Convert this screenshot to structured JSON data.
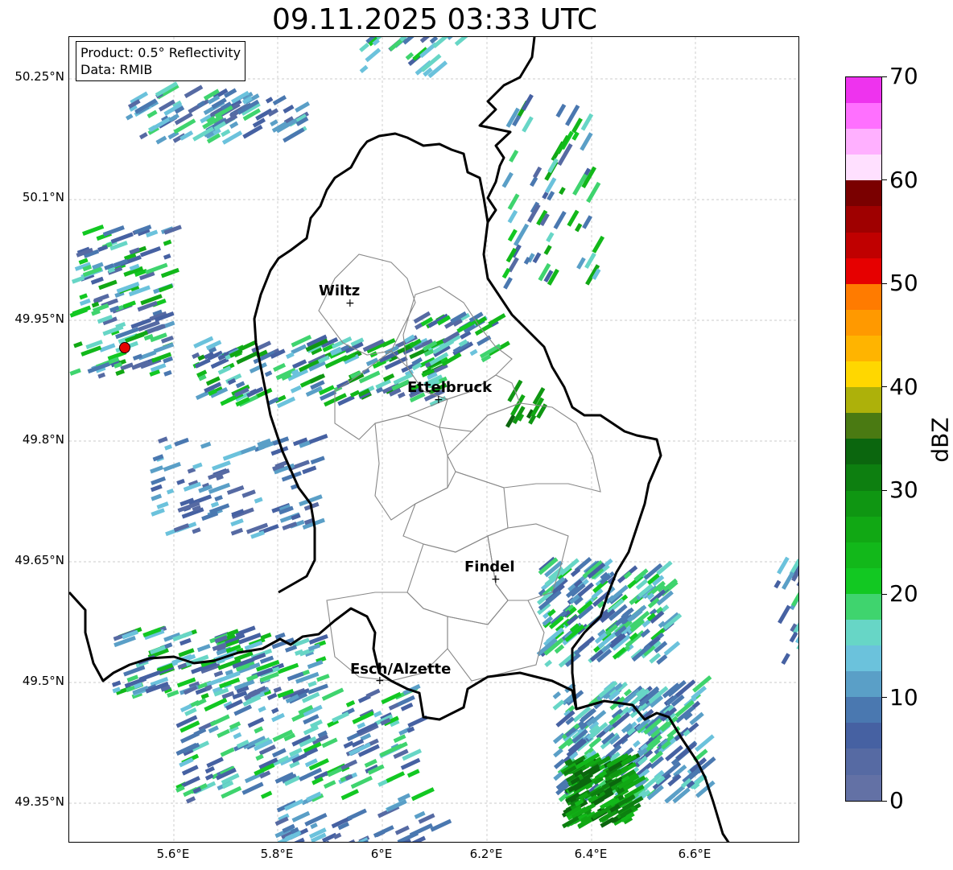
{
  "title": "09.11.2025 03:33 UTC",
  "info_box": {
    "product": "Product: 0.5° Reflectivity",
    "data": "Data: RMIB"
  },
  "axes": {
    "lat_labels": [
      "50.25°N",
      "50.1°N",
      "49.95°N",
      "49.8°N",
      "49.65°N",
      "49.5°N",
      "49.35°N"
    ],
    "lon_labels": [
      "5.6°E",
      "5.8°E",
      "6°E",
      "6.2°E",
      "6.4°E",
      "6.6°E"
    ]
  },
  "places": [
    {
      "name": "Wiltz"
    },
    {
      "name": "Ettelbruck"
    },
    {
      "name": "Findel"
    },
    {
      "name": "Esch/Alzette"
    }
  ],
  "colorbar": {
    "unit": "dBZ",
    "ticks": [
      "0",
      "10",
      "20",
      "30",
      "40",
      "50",
      "60",
      "70"
    ],
    "colors": [
      "#6371a5",
      "#566aa3",
      "#4661a2",
      "#4a78b0",
      "#5a9fc7",
      "#6bc2dc",
      "#67d6c6",
      "#3fd46e",
      "#12c822",
      "#12b81a",
      "#11a814",
      "#0f9612",
      "#0d7f10",
      "#0b660e",
      "#4a7a12",
      "#adb10a",
      "#ffd700",
      "#ffb400",
      "#ff9900",
      "#ff7b00",
      "#e60000",
      "#c00000",
      "#9f0000",
      "#7a0000",
      "#ffe0ff",
      "#ffb0ff",
      "#ff70ff",
      "#ee33ee"
    ]
  },
  "map": {
    "radar_site_color": "#e60000",
    "border_color": "#000000",
    "canton_color": "#888888",
    "grid": true
  }
}
